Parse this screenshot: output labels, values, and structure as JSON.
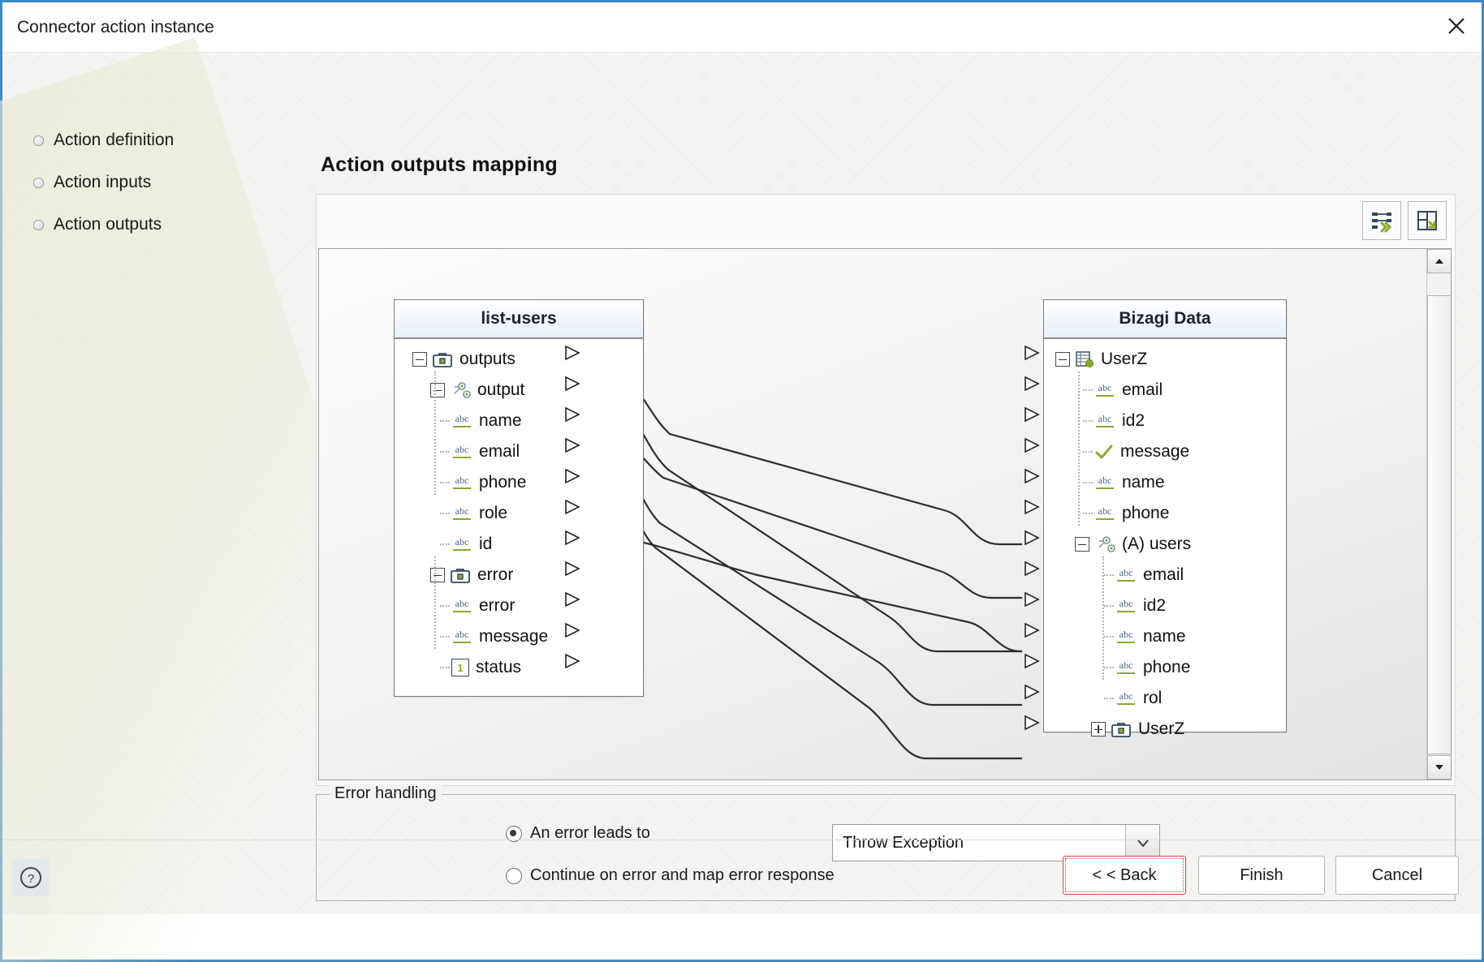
{
  "window": {
    "title": "Connector action instance",
    "close_icon": "close-icon"
  },
  "nav": {
    "items": [
      {
        "label": "Action definition"
      },
      {
        "label": "Action inputs"
      },
      {
        "label": "Action outputs"
      }
    ]
  },
  "main": {
    "page_title": "Action outputs mapping",
    "toolbar": [
      {
        "name": "auto-map-button",
        "icon": "auto-map-icon"
      },
      {
        "name": "save-layout-button",
        "icon": "save-layout-icon"
      }
    ]
  },
  "mapping": {
    "source": {
      "title": "list-users",
      "rows": [
        {
          "label": "outputs",
          "icon": "briefcase-icon",
          "indent": 0,
          "expander": "minus",
          "connector": true
        },
        {
          "label": "output",
          "icon": "object-node-icon",
          "indent": 1,
          "expander": "minus",
          "connector": true
        },
        {
          "label": "name",
          "icon": "abc-icon",
          "indent": 2,
          "expander": "none",
          "connector": true
        },
        {
          "label": "email",
          "icon": "abc-icon",
          "indent": 2,
          "expander": "none",
          "connector": true
        },
        {
          "label": "phone",
          "icon": "abc-icon",
          "indent": 2,
          "expander": "none",
          "connector": true
        },
        {
          "label": "role",
          "icon": "abc-icon",
          "indent": 2,
          "expander": "none",
          "connector": true
        },
        {
          "label": "id",
          "icon": "abc-icon",
          "indent": 2,
          "expander": "none",
          "connector": true
        },
        {
          "label": "error",
          "icon": "briefcase-icon",
          "indent": 1,
          "expander": "minus",
          "connector": true
        },
        {
          "label": "error",
          "icon": "abc-icon",
          "indent": 2,
          "expander": "none",
          "connector": true
        },
        {
          "label": "message",
          "icon": "abc-icon",
          "indent": 2,
          "expander": "none",
          "connector": true
        },
        {
          "label": "status",
          "icon": "number-icon",
          "indent": 2,
          "expander": "none",
          "connector": true
        }
      ]
    },
    "target": {
      "title": "Bizagi Data",
      "rows": [
        {
          "label": "UserZ",
          "icon": "table-icon",
          "indent": 0,
          "expander": "minus",
          "connector": true
        },
        {
          "label": "email",
          "icon": "abc-icon",
          "indent": 1,
          "expander": "none",
          "connector": true
        },
        {
          "label": "id2",
          "icon": "abc-icon",
          "indent": 1,
          "expander": "none",
          "connector": true
        },
        {
          "label": "message",
          "icon": "check-icon",
          "indent": 1,
          "expander": "none",
          "connector": true
        },
        {
          "label": "name",
          "icon": "abc-icon",
          "indent": 1,
          "expander": "none",
          "connector": true
        },
        {
          "label": "phone",
          "icon": "abc-icon",
          "indent": 1,
          "expander": "none",
          "connector": true
        },
        {
          "label": "(A) users",
          "icon": "object-node-icon",
          "indent": 1,
          "expander": "minus",
          "connector": true
        },
        {
          "label": "email",
          "icon": "abc-icon",
          "indent": 2,
          "expander": "none",
          "connector": true
        },
        {
          "label": "id2",
          "icon": "abc-icon",
          "indent": 2,
          "expander": "none",
          "connector": true
        },
        {
          "label": "name",
          "icon": "abc-icon",
          "indent": 2,
          "expander": "none",
          "connector": true
        },
        {
          "label": "phone",
          "icon": "abc-icon",
          "indent": 2,
          "expander": "none",
          "connector": true
        },
        {
          "label": "rol",
          "icon": "abc-icon",
          "indent": 2,
          "expander": "none",
          "connector": true
        },
        {
          "label": "UserZ",
          "icon": "briefcase-icon",
          "indent": 1,
          "expander": "plus",
          "connector": true
        }
      ]
    },
    "links": [
      {
        "from": "output",
        "to": "(A) users"
      },
      {
        "from": "name",
        "to": "name"
      },
      {
        "from": "email",
        "to": "email"
      },
      {
        "from": "phone",
        "to": "phone"
      },
      {
        "from": "role",
        "to": "rol"
      },
      {
        "from": "id",
        "to": "id2"
      }
    ],
    "scrollbar": {
      "up_icon": "triangle-up-icon",
      "down_icon": "triangle-down-icon"
    }
  },
  "error_handling": {
    "legend": "Error handling",
    "option_leads_to": "An error leads to",
    "option_continue": "Continue on error and map error response",
    "selected": "An error leads to",
    "dropdown_value": "Throw Exception"
  },
  "footer": {
    "help_icon": "help-icon",
    "back_label": "< < Back",
    "finish_label": "Finish",
    "cancel_label": "Cancel"
  },
  "colors": {
    "accent": "#3d8bc4",
    "icon_green": "#8aa92b",
    "icon_dark": "#33475a"
  }
}
